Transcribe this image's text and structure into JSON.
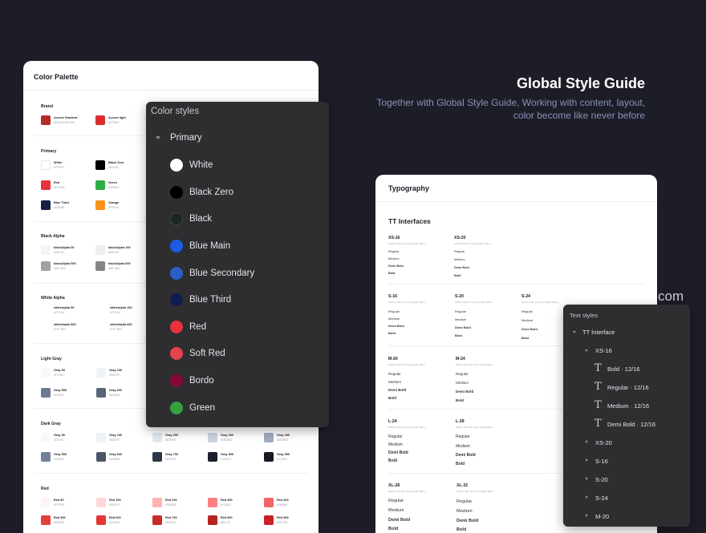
{
  "hero": {
    "title": "Global Style Guide",
    "subtitle": "Together with Global Style Guide, Working with content, layout, color become like never before"
  },
  "background_fragment": "com",
  "palette": {
    "title": "Color Palette",
    "sections": [
      {
        "title": "Brand",
        "items": [
          {
            "name": "Accent Gradient",
            "hex": "#E02424 #9F2020",
            "color": "#b72a2a"
          },
          {
            "name": "Accent light",
            "hex": "#E72A23",
            "color": "#dc2d2d"
          }
        ]
      },
      {
        "title": "Primary",
        "items": [
          {
            "name": "White",
            "hex": "#FFFFFF",
            "color": "#ffffff"
          },
          {
            "name": "Black Zero",
            "hex": "#000000",
            "color": "#000000"
          },
          {
            "name": "Red",
            "hex": "#E72A2D",
            "color": "#e8333a"
          },
          {
            "name": "Green",
            "hex": "#2AB443",
            "color": "#2fac45"
          },
          {
            "name": "Blue Third",
            "hex": "#1B2D5E",
            "color": "#142044"
          },
          {
            "name": "Orange",
            "hex": "#FF9100",
            "color": "#f7931a"
          }
        ]
      },
      {
        "title": "Black Alpha",
        "items": [
          {
            "name": "blackAlpha 50",
            "hex": "#000 4%",
            "color": "#f5f5f5"
          },
          {
            "name": "blackAlpha 100",
            "hex": "#000 6%",
            "color": "#efefef"
          },
          {
            "name": "blackAlpha 500",
            "hex": "#000 36%",
            "color": "#a3a3a3"
          },
          {
            "name": "blackAlpha 600",
            "hex": "#000 48%",
            "color": "#858585"
          }
        ]
      },
      {
        "title": "White Alpha",
        "items": [
          {
            "name": "whiteAlpha 50",
            "hex": "#FFF 4%",
            "color": "#ffffff"
          },
          {
            "name": "whiteAlpha 100",
            "hex": "#FFF 6%",
            "color": "#ffffff"
          },
          {
            "name": "whiteAlpha 500",
            "hex": "#FFF 36%",
            "color": "#ffffff"
          },
          {
            "name": "whiteAlpha 600",
            "hex": "#FFF 48%",
            "color": "#ffffff"
          }
        ]
      },
      {
        "title": "Light Gray",
        "items": [
          {
            "name": "Gray 50",
            "hex": "#F7FAFC",
            "color": "#f7f9fc"
          },
          {
            "name": "Gray 100",
            "hex": "#EDF2F7",
            "color": "#edf2f7"
          },
          {
            "name": "Gray 500",
            "hex": "#718096",
            "color": "#6c7a91"
          },
          {
            "name": "Gray 600",
            "hex": "#4A5568",
            "color": "#5a6478"
          }
        ]
      },
      {
        "title": "Dark Gray",
        "items": [
          {
            "name": "Gray 50",
            "hex": "#F7FAFC",
            "color": "#f7f9fc"
          },
          {
            "name": "Gray 100",
            "hex": "#EDF2F7",
            "color": "#edf2f7"
          },
          {
            "name": "Gray 200",
            "hex": "#E2E8F0",
            "color": "#e2e8f0"
          },
          {
            "name": "Gray 300",
            "hex": "#CBD5E0",
            "color": "#cbd5e0"
          },
          {
            "name": "Gray 400",
            "hex": "#A0AEC0",
            "color": "#a0aec0"
          },
          {
            "name": "Gray 500",
            "hex": "#718096",
            "color": "#718096"
          },
          {
            "name": "Gray 600",
            "hex": "#4A5568",
            "color": "#4a5568"
          },
          {
            "name": "Gray 700",
            "hex": "#2D3748",
            "color": "#2d3748"
          },
          {
            "name": "Gray 800",
            "hex": "#1A202C",
            "color": "#1a202c"
          },
          {
            "name": "Gray 900",
            "hex": "#171923",
            "color": "#171923"
          }
        ]
      },
      {
        "title": "Red",
        "items": [
          {
            "name": "Red 50",
            "hex": "#FFF5F5",
            "color": "#fff5f5"
          },
          {
            "name": "Red 100",
            "hex": "#FED7D7",
            "color": "#fed7d7"
          },
          {
            "name": "Red 200",
            "hex": "#FEB2B2",
            "color": "#feb2b2"
          },
          {
            "name": "Red 300",
            "hex": "#FC8181",
            "color": "#fc8181"
          },
          {
            "name": "Red 400",
            "hex": "#F56565",
            "color": "#f56565"
          },
          {
            "name": "Red 500",
            "hex": "#E53E3E",
            "color": "#e53e3e"
          },
          {
            "name": "Red 600",
            "hex": "#C53030",
            "color": "#e53535"
          },
          {
            "name": "Red 700",
            "hex": "#9B2C2C",
            "color": "#c92a2a"
          },
          {
            "name": "Red 800",
            "hex": "#822727",
            "color": "#b52222"
          },
          {
            "name": "Red 900",
            "hex": "#63171B",
            "color": "#cc1f2a"
          }
        ]
      }
    ]
  },
  "color_styles": {
    "title": "Color styles",
    "group": "Primary",
    "items": [
      {
        "label": "White",
        "color": "#ffffff"
      },
      {
        "label": "Black Zero",
        "color": "#000000"
      },
      {
        "label": "Black",
        "color": "#1b2622"
      },
      {
        "label": "Blue Main",
        "color": "#1a5ce8"
      },
      {
        "label": "Blue Secondary",
        "color": "#2a5ec9"
      },
      {
        "label": "Blue Third",
        "color": "#0f1c4f"
      },
      {
        "label": "Red",
        "color": "#e8333a"
      },
      {
        "label": "Soft Red",
        "color": "#e6424f"
      },
      {
        "label": "Bordo",
        "color": "#870838"
      },
      {
        "label": "Green",
        "color": "#34a23f"
      }
    ]
  },
  "typography": {
    "title": "Typography",
    "family": "TT Interfaces",
    "weights": [
      "Regular",
      "Medium",
      "Demi Bold",
      "Bold"
    ],
    "styles": [
      {
        "name": "XS-16",
        "meta": "12/16 ( Size 12 / Line height 16px )"
      },
      {
        "name": "XS-20",
        "meta": "12/20 ( Size 12 / Line height 20px )"
      },
      {
        "name": "S-16",
        "meta": "14/16 ( Size 14 / Line height 16px )"
      },
      {
        "name": "S-20",
        "meta": "14/20 ( Size 14 / Line height 20px )"
      },
      {
        "name": "S-24",
        "meta": "14/24 ( Size 14 / Line height 24px )"
      },
      {
        "name": "M-20",
        "meta": "16/20 ( Size 16 / Line height 20px )"
      },
      {
        "name": "M-24",
        "meta": "16/24 ( Size 16 / Line height 24px )"
      },
      {
        "name": "L-24",
        "meta": "18/24 ( Size 18 / Line height 24px )"
      },
      {
        "name": "L-28",
        "meta": "18/28 ( Size 18 / Line height 28px )"
      },
      {
        "name": "XL-28",
        "meta": "20/28 ( Size 20 / Line height 28px )"
      },
      {
        "name": "XL-32",
        "meta": "20/32 ( Size 20 / Line height 32px )"
      }
    ]
  },
  "text_styles": {
    "title": "Text styles",
    "family": "TT İnterface",
    "expanded_group": "XS-16",
    "expanded_items": [
      "Bold · 12/16",
      "Regular · 12/16",
      "Medium · 12/16",
      "Demi Bold · 12/16"
    ],
    "collapsed_groups": [
      "XS-20",
      "S-16",
      "S-20",
      "S-24",
      "M-20"
    ]
  }
}
